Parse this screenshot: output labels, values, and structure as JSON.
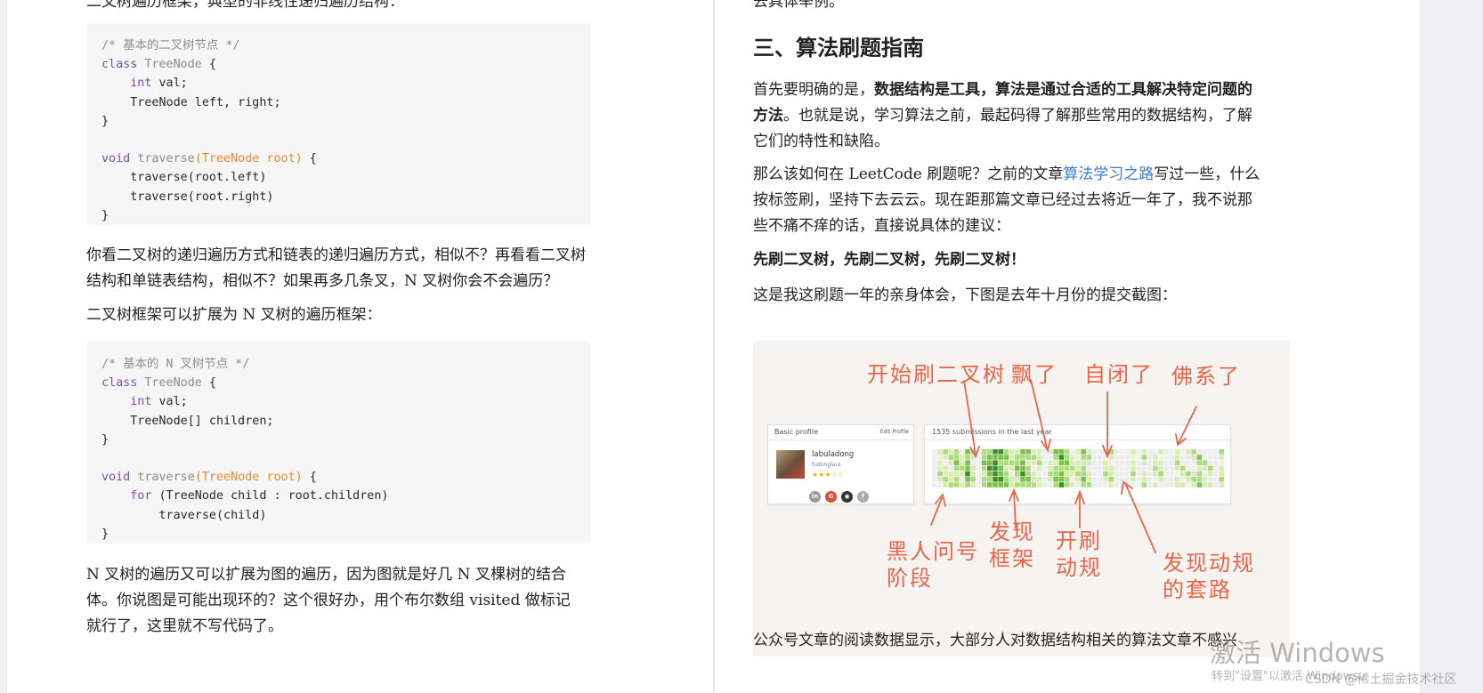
{
  "left": {
    "top_cut": "二叉树遍历框架，典型的非线性递归遍历结构：",
    "code1": [
      [
        [
          "c-comment",
          "/* 基本的二叉树节点 */"
        ]
      ],
      [
        [
          "c-kw",
          "class"
        ],
        [
          "",
          " "
        ],
        [
          "c-fn",
          "TreeNode"
        ],
        [
          "",
          " {"
        ]
      ],
      [
        [
          "",
          "    "
        ],
        [
          "c-kw",
          "int"
        ],
        [
          "",
          " val;"
        ]
      ],
      [
        [
          "",
          "    TreeNode left, right;"
        ]
      ],
      [
        [
          "",
          "}"
        ]
      ],
      [
        [
          "",
          ""
        ]
      ],
      [
        [
          "c-kw",
          "void"
        ],
        [
          "",
          " "
        ],
        [
          "c-fn",
          "traverse"
        ],
        [
          "c-param",
          "(TreeNode root)"
        ],
        [
          "",
          " {"
        ]
      ],
      [
        [
          "",
          "    traverse(root.left)"
        ]
      ],
      [
        [
          "",
          "    traverse(root.right)"
        ]
      ],
      [
        [
          "",
          "}"
        ]
      ]
    ],
    "para1": "你看二叉树的递归遍历方式和链表的递归遍历方式，相似不？再看看二叉树结构和单链表结构，相似不？如果再多几条叉，N 叉树你会不会遍历？",
    "para2": "二叉树框架可以扩展为 N 叉树的遍历框架：",
    "code2": [
      [
        [
          "c-comment",
          "/* 基本的 N 叉树节点 */"
        ]
      ],
      [
        [
          "c-kw",
          "class"
        ],
        [
          "",
          " "
        ],
        [
          "c-fn",
          "TreeNode"
        ],
        [
          "",
          " {"
        ]
      ],
      [
        [
          "",
          "    "
        ],
        [
          "c-kw",
          "int"
        ],
        [
          "",
          " val;"
        ]
      ],
      [
        [
          "",
          "    TreeNode[] children;"
        ]
      ],
      [
        [
          "",
          "}"
        ]
      ],
      [
        [
          "",
          ""
        ]
      ],
      [
        [
          "c-kw",
          "void"
        ],
        [
          "",
          " "
        ],
        [
          "c-fn",
          "traverse"
        ],
        [
          "c-param",
          "(TreeNode root)"
        ],
        [
          "",
          " {"
        ]
      ],
      [
        [
          "",
          "    "
        ],
        [
          "c-kw",
          "for"
        ],
        [
          "",
          " (TreeNode child : root.children)"
        ]
      ],
      [
        [
          "",
          "        traverse(child)"
        ]
      ],
      [
        [
          "",
          "}"
        ]
      ]
    ],
    "para3": "N 叉树的遍历又可以扩展为图的遍历，因为图就是好几 N 叉棵树的结合体。你说图是可能出现环的？这个很好办，用个布尔数组 visited 做标记就行了，这里就不写代码了。"
  },
  "right": {
    "top_cut": "去具体举例。",
    "heading": "三、算法刷题指南",
    "para1_a": "首先要明确的是，",
    "para1_b": "数据结构是工具，算法是通过合适的工具解决特定问题的方法",
    "para1_c": "。也就是说，学习算法之前，最起码得了解那些常用的数据结构，了解它们的特性和缺陷。",
    "para2_a": "那么该如何在 LeetCode 刷题呢？之前的文章",
    "para2_link": "算法学习之路",
    "para2_c": "写过一些，什么按标签刷，坚持下去云云。现在距那篇文章已经过去将近一年了，我不说那些不痛不痒的话，直接说具体的建议：",
    "para3": "先刷二叉树，先刷二叉树，先刷二叉树！",
    "para4": "这是我这刷题一年的亲身体会，下图是去年十月份的提交截图：",
    "para5": "公众号文章的阅读数据显示，大部分人对数据结构相关的算法文章不感兴"
  },
  "figure": {
    "profile_card_title": "Basic profile",
    "edit_profile": "Edit Profile",
    "username": "labuladong",
    "handle": "fudonglai ℹ",
    "stars": "★★★☆☆",
    "submissions_title": "1535 submissions in the last year",
    "social_icons": [
      "in",
      "G",
      "◉",
      "f"
    ],
    "social_icon_names": [
      "linkedin-icon",
      "google-icon",
      "github-icon",
      "facebook-icon"
    ],
    "notes_top": [
      "开始刷二叉树",
      "飘了",
      "自闭了",
      "佛系了"
    ],
    "notes_bottom": [
      "黑人问号\n阶段",
      "发现\n框架",
      "开刷\n动规",
      "发现动规\n的套路"
    ],
    "heatmap": {
      "weeks": 53,
      "days": 7,
      "levels": [
        0,
        1,
        1,
        1,
        2,
        1,
        3,
        1,
        0,
        2,
        3,
        4,
        3,
        2,
        1,
        2,
        3,
        2,
        1,
        1,
        0,
        1,
        2,
        3,
        2,
        1,
        1,
        2,
        1,
        0,
        0,
        1,
        1,
        0,
        0,
        0,
        1,
        0,
        1,
        0,
        1,
        1,
        0,
        0,
        1,
        1,
        1,
        1,
        2,
        1,
        1,
        0,
        1
      ],
      "colors": [
        "#eeeeee",
        "#d8edb3",
        "#add980",
        "#7fbf4d",
        "#3f8f2a"
      ]
    }
  },
  "watermark": {
    "activate_title": "激活 Windows",
    "activate_sub": "转到\"设置\"以激活 Windows。",
    "site": "CSDN @稀土掘金技术社区"
  }
}
